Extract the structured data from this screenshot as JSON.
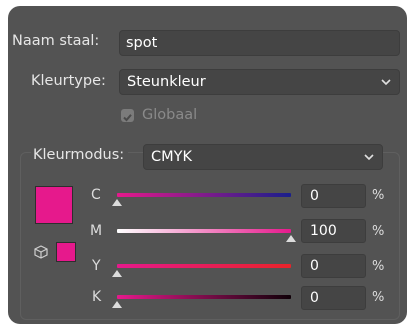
{
  "swatch_name": {
    "label": "Naam staal:",
    "value": "spot"
  },
  "color_type": {
    "label": "Kleurtype:",
    "value": "Steunkleur"
  },
  "global": {
    "label": "Globaal",
    "checked": true
  },
  "color_mode": {
    "label": "Kleurmodus:",
    "value": "CMYK"
  },
  "swatch_color": "#e6198c",
  "channels": [
    {
      "label": "C",
      "value": "0",
      "unit": "%",
      "level": 0.0
    },
    {
      "label": "M",
      "value": "100",
      "unit": "%",
      "level": 1.0
    },
    {
      "label": "Y",
      "value": "0",
      "unit": "%",
      "level": 0.0
    },
    {
      "label": "K",
      "value": "0",
      "unit": "%",
      "level": 0.0
    }
  ],
  "icons": {
    "chevron": "chevron-down-icon",
    "gamut": "cube-icon",
    "check": "checkmark-icon"
  }
}
